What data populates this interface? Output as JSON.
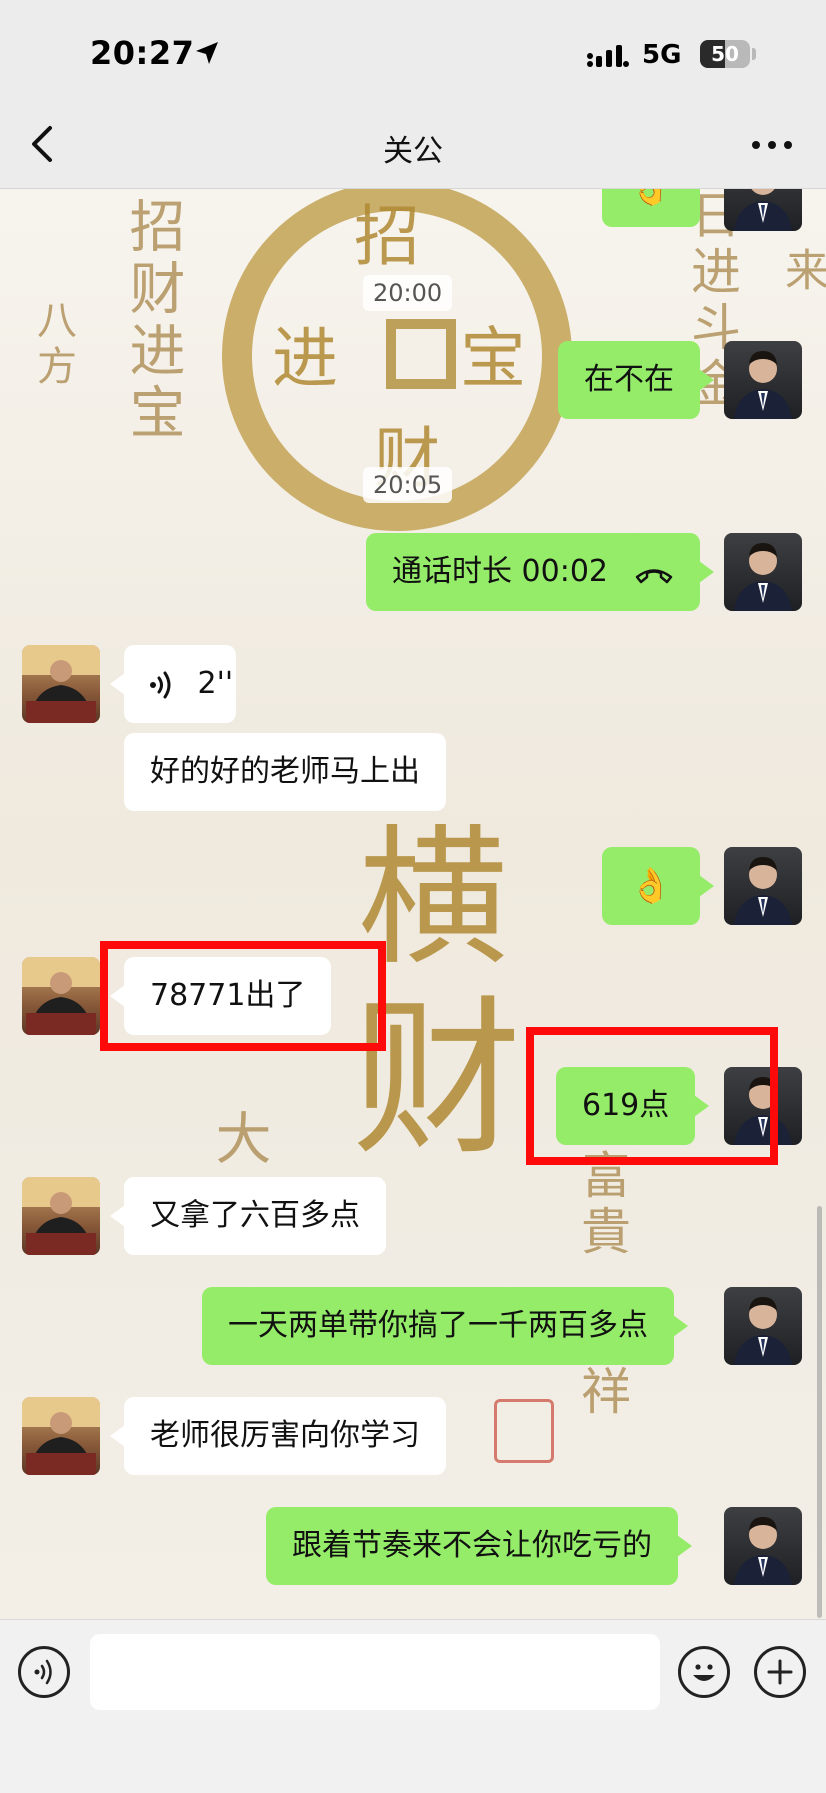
{
  "status_bar": {
    "time": "20:27",
    "network": "5G",
    "battery": "50",
    "battery_level": 0.5
  },
  "header": {
    "title": "关公"
  },
  "background": {
    "coin_chars": [
      "招",
      "宝",
      "财",
      "进"
    ],
    "left_column": "招财进宝",
    "left_column_small": "八方",
    "right_column_a": "日进斗金",
    "right_column_b": "来",
    "big_chars": [
      "横",
      "财"
    ],
    "left_side": "大",
    "right_side_a": "富貴",
    "right_side_b": "祥"
  },
  "messages": [
    {
      "type": "text",
      "side": "right",
      "content": "👌"
    },
    {
      "type": "time",
      "content": "20:00"
    },
    {
      "type": "text",
      "side": "right",
      "content": "在不在"
    },
    {
      "type": "time",
      "content": "20:05"
    },
    {
      "type": "call",
      "side": "right",
      "content": "通话时长 00:02"
    },
    {
      "type": "voice",
      "side": "left",
      "duration": "2''"
    },
    {
      "type": "text",
      "side": "left",
      "content": "好的好的老师马上出"
    },
    {
      "type": "text",
      "side": "right",
      "content": "👌"
    },
    {
      "type": "text",
      "side": "left",
      "content": "78771出了",
      "highlighted": true
    },
    {
      "type": "text",
      "side": "right",
      "content": "619点",
      "highlighted": true
    },
    {
      "type": "text",
      "side": "left",
      "content": "又拿了六百多点"
    },
    {
      "type": "text",
      "side": "right",
      "content": "一天两单带你搞了一千两百多点"
    },
    {
      "type": "text",
      "side": "left",
      "content": "老师很厉害向你学习"
    },
    {
      "type": "text",
      "side": "right",
      "content": "跟着节奏来不会让你吃亏的"
    }
  ],
  "colors": {
    "self_bubble": "#95ec69",
    "other_bubble": "#ffffff",
    "highlight": "#ff0a0a"
  }
}
